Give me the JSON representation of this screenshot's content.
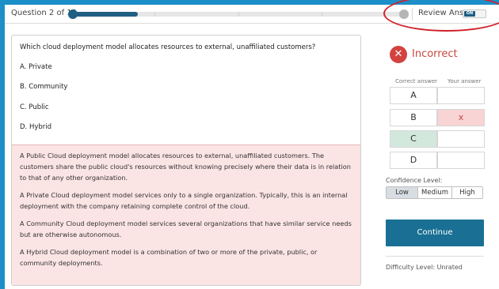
{
  "header": {
    "question_counter": "Question 2 of 10",
    "progress_fraction": 0.2,
    "review_label": "Review Answer",
    "review_toggle": "ON"
  },
  "question": {
    "text": "Which cloud deployment model allocates resources to external, unaffiliated customers?",
    "choices": [
      "A. Private",
      "B. Community",
      "C. Public",
      "D. Hybrid"
    ]
  },
  "explanation": [
    "A Public Cloud deployment model allocates resources to external, unaffiliated customers. The customers share the public cloud's resources without knowing precisely where their data is in relation to that of any other organization.",
    "A Private Cloud deployment model services only to a single organization. Typically, this is an internal deployment with the company retaining complete control of the cloud.",
    "A Community Cloud deployment model services several organizations that have similar service needs but are otherwise autonomous.",
    "A Hybrid Cloud deployment model is a combination of two or more of the private, public, or community deployments."
  ],
  "result": {
    "status": "Incorrect",
    "icon": "x-circle-icon",
    "correct_header": "Correct answer",
    "your_header": "Your answer",
    "rows": [
      {
        "letter": "A",
        "correct": false,
        "yours": ""
      },
      {
        "letter": "B",
        "correct": false,
        "yours": "x"
      },
      {
        "letter": "C",
        "correct": true,
        "yours": ""
      },
      {
        "letter": "D",
        "correct": false,
        "yours": ""
      }
    ]
  },
  "confidence": {
    "label": "Confidence Level:",
    "options": [
      "Low",
      "Medium",
      "High"
    ],
    "selected": "Low"
  },
  "actions": {
    "continue_label": "Continue"
  },
  "difficulty": "Difficulty Level: Unrated",
  "colors": {
    "accent": "#1a7094",
    "incorrect": "#c9453f",
    "correct_bg": "#d3e8dd",
    "wrong_bg": "#f8d4d4",
    "explain_bg": "#fbe4e4",
    "frame": "#1c8fc8"
  }
}
